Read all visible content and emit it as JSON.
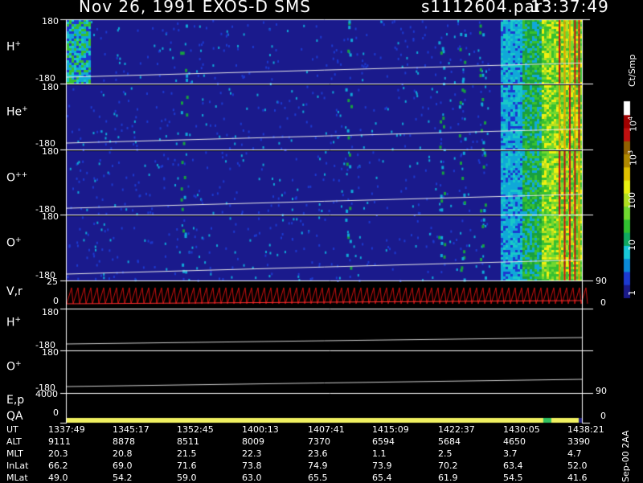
{
  "header": {
    "title": "Nov 26, 1991    EXOS-D SMS",
    "file": "s1112604.par",
    "time": "13:37:49"
  },
  "panels": [
    {
      "base": "H",
      "sup": "+",
      "ymax": "180",
      "ymin": "-180"
    },
    {
      "base": "He",
      "sup": "+",
      "ymax": "180",
      "ymin": "-180"
    },
    {
      "base": "O",
      "sup": "++",
      "ymax": "180",
      "ymin": "-180"
    },
    {
      "base": "O",
      "sup": "+",
      "ymax": "180",
      "ymin": "-180"
    }
  ],
  "vr_panel": {
    "label": "V,r",
    "ymax": "25",
    "ymin": "0",
    "right_top": "90",
    "right_bottom": "0"
  },
  "h_panel": {
    "base": "H",
    "sup": "+",
    "ymax": "180",
    "ymin": "-180"
  },
  "o_panel": {
    "base": "O",
    "sup": "+",
    "ymax": "180",
    "ymin": "-180"
  },
  "ep_panel": {
    "label_e": "E,p",
    "label_qa": "QA",
    "ymax": "4000",
    "ymin": "0",
    "right_top": "90",
    "right_bottom": "0"
  },
  "colorbar": {
    "units": "Ct/Smp",
    "labels": [
      "10",
      "10",
      "100",
      "10",
      "1"
    ],
    "exponents": [
      "4",
      "3",
      "",
      "",
      ""
    ],
    "colors": [
      "#1a1a8a",
      "#1c3ad0",
      "#0a8ad8",
      "#18c8d8",
      "#10a860",
      "#30c030",
      "#70d830",
      "#b0e020",
      "#e8f010",
      "#e0c000",
      "#b08800",
      "#906000",
      "#c01010",
      "#a00000",
      "#ffffff"
    ]
  },
  "footer": {
    "rows": [
      {
        "label": "UT",
        "values": [
          "1337:49",
          "1345:17",
          "1352:45",
          "1400:13",
          "1407:41",
          "1415:09",
          "1422:37",
          "1430:05",
          "1438:21"
        ]
      },
      {
        "label": "ALT",
        "values": [
          "9111",
          "8878",
          "8511",
          "8009",
          "7370",
          "6594",
          "5684",
          "4650",
          "3390"
        ]
      },
      {
        "label": "MLT",
        "values": [
          "20.3",
          "20.8",
          "21.5",
          "22.3",
          "23.6",
          "1.1",
          "2.5",
          "3.7",
          "4.7"
        ]
      },
      {
        "label": "InLat",
        "values": [
          "66.2",
          "69.0",
          "71.6",
          "73.8",
          "74.9",
          "73.9",
          "70.2",
          "63.4",
          "52.0"
        ]
      },
      {
        "label": "MLat",
        "values": [
          "49.0",
          "54.2",
          "59.0",
          "63.0",
          "65.5",
          "65.4",
          "61.9",
          "54.5",
          "41.6"
        ]
      }
    ],
    "side_note": "Sep-00  2AA"
  },
  "chart_data": {
    "type": "heatmap",
    "title": "Nov 26, 1991    EXOS-D SMS",
    "x": [
      "1337:49",
      "1345:17",
      "1352:45",
      "1400:13",
      "1407:41",
      "1415:09",
      "1422:37",
      "1430:05",
      "1438:21"
    ],
    "xlabel": "UT",
    "colorbar_label": "Ct/Smp",
    "colorbar_range": [
      1,
      10000
    ],
    "colorbar_scale": "log",
    "panels": [
      {
        "name": "H+",
        "ylim": [
          -180,
          180
        ]
      },
      {
        "name": "He+",
        "ylim": [
          -180,
          180
        ]
      },
      {
        "name": "O++",
        "ylim": [
          -180,
          180
        ]
      },
      {
        "name": "O+",
        "ylim": [
          -180,
          180
        ]
      },
      {
        "name": "V,r",
        "ylim": [
          0,
          25
        ],
        "right_ylim": [
          0,
          90
        ]
      },
      {
        "name": "H+",
        "ylim": [
          -180,
          180
        ]
      },
      {
        "name": "O+",
        "ylim": [
          -180,
          180
        ]
      },
      {
        "name": "E,p",
        "ylim": [
          0,
          4000
        ],
        "right_ylim": [
          0,
          90
        ]
      }
    ]
  }
}
